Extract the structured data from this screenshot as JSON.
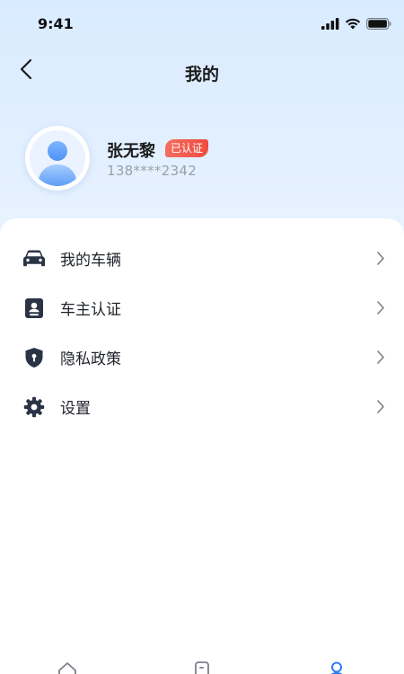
{
  "status_bar": {
    "time": "9:41"
  },
  "nav": {
    "title": "我的",
    "back_icon": "chevron-left-icon"
  },
  "profile": {
    "name": "张无黎",
    "badge": "已认证",
    "phone": "138****2342",
    "avatar_icon": "user-avatar-icon"
  },
  "menu": {
    "items": [
      {
        "label": "我的车辆",
        "icon": "car-icon"
      },
      {
        "label": "车主认证",
        "icon": "id-card-icon"
      },
      {
        "label": "隐私政策",
        "icon": "shield-lock-icon"
      },
      {
        "label": "设置",
        "icon": "gear-icon"
      }
    ]
  },
  "tab_bar": {
    "tabs": [
      {
        "icon": "home-icon"
      },
      {
        "icon": "document-icon"
      },
      {
        "icon": "profile-icon",
        "active": true
      }
    ]
  },
  "colors": {
    "accent": "#2f7cf6",
    "badge": "#ef4b3f",
    "icon": "#2b3445",
    "chevron": "#7a7f87",
    "phone": "#9aa0a6"
  }
}
